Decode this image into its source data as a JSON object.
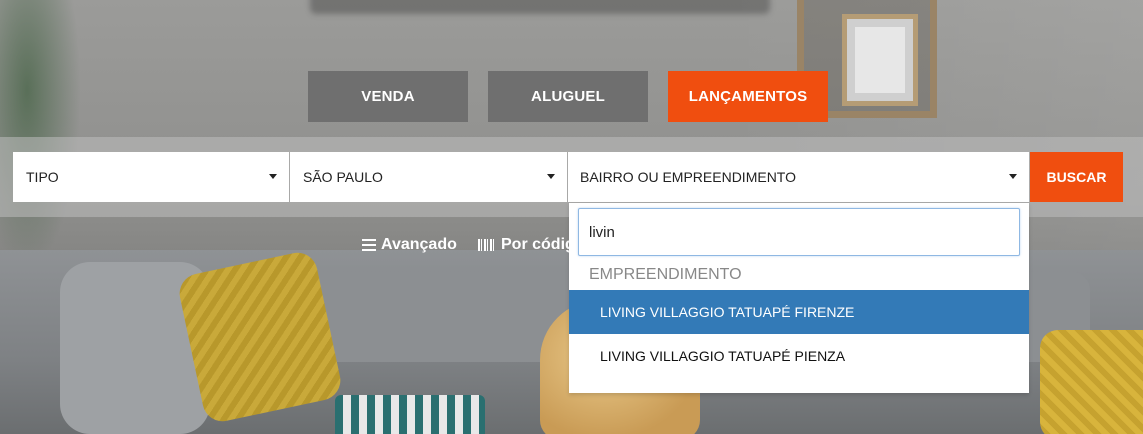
{
  "tabs": [
    {
      "label": "VENDA"
    },
    {
      "label": "ALUGUEL"
    },
    {
      "label": "LANÇAMENTOS",
      "active": true
    }
  ],
  "search": {
    "tipo": "TIPO",
    "cidade": "SÃO PAULO",
    "bairro": "BAIRRO OU EMPREENDIMENTO",
    "button": "BUSCAR"
  },
  "links": {
    "avancado": "Avançado",
    "codigo": "Por códig"
  },
  "dropdown": {
    "query": "livin",
    "group": "EMPREENDIMENTO",
    "options": [
      {
        "label": "LIVING VILLAGGIO TATUAPÉ FIRENZE",
        "highlighted": true
      },
      {
        "label": "LIVING VILLAGGIO TATUAPÉ PIENZA",
        "highlighted": false
      }
    ]
  },
  "colors": {
    "accent": "#f04e0f",
    "tab_gray": "#6f6f6f",
    "highlight": "#337ab7"
  },
  "icons": [
    "menu-icon",
    "barcode-icon",
    "caret-down-icon"
  ]
}
